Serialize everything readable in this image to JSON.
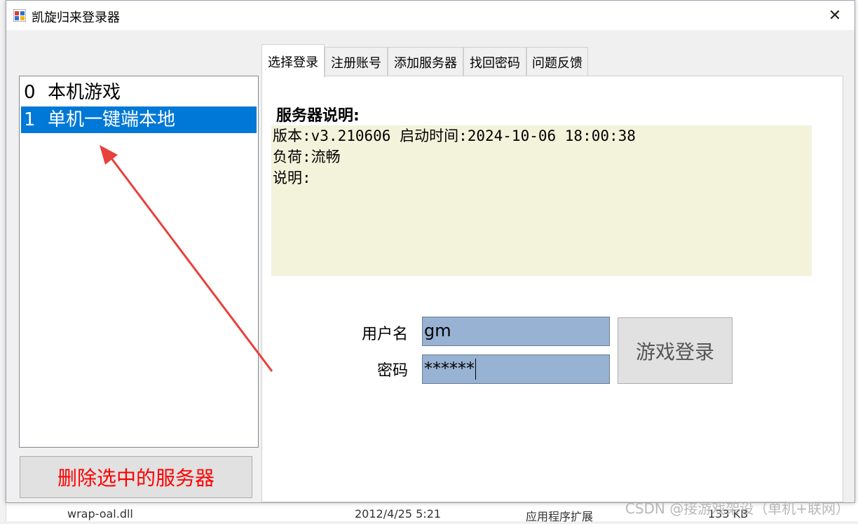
{
  "window": {
    "title": "凯旋归来登录器",
    "close_glyph": "✕"
  },
  "server_list": {
    "items": [
      {
        "index": "0",
        "name": "本机游戏",
        "selected": false
      },
      {
        "index": "1",
        "name": "单机一键端本地",
        "selected": true
      }
    ]
  },
  "delete_button": {
    "label": "删除选中的服务器"
  },
  "tabs": [
    {
      "label": "选择登录",
      "active": true
    },
    {
      "label": "注册账号",
      "active": false
    },
    {
      "label": "添加服务器",
      "active": false
    },
    {
      "label": "找回密码",
      "active": false
    },
    {
      "label": "问题反馈",
      "active": false
    }
  ],
  "server_info": {
    "heading": "服务器说明:",
    "lines": [
      "版本:v3.210606 启动时间:2024-10-06 18:00:38",
      "负荷:流畅",
      "说明:"
    ]
  },
  "login": {
    "username_label": "用户名",
    "username_value": "gm",
    "password_label": "密码",
    "password_value": "******",
    "submit_label": "游戏登录"
  },
  "background": {
    "file_name": "wrap-oal.dll",
    "file_date": "2012/4/25 5:21",
    "file_type": "应用程序扩展",
    "file_size": "133 KB"
  },
  "watermark": "CSDN @接游戏架设（单机+联网）",
  "colors": {
    "selection": "#0078d7",
    "input_bg": "#97b2d3",
    "info_bg": "#f3f3dc",
    "delete_text": "#ff0000",
    "annotation_arrow": "#e8403a"
  }
}
